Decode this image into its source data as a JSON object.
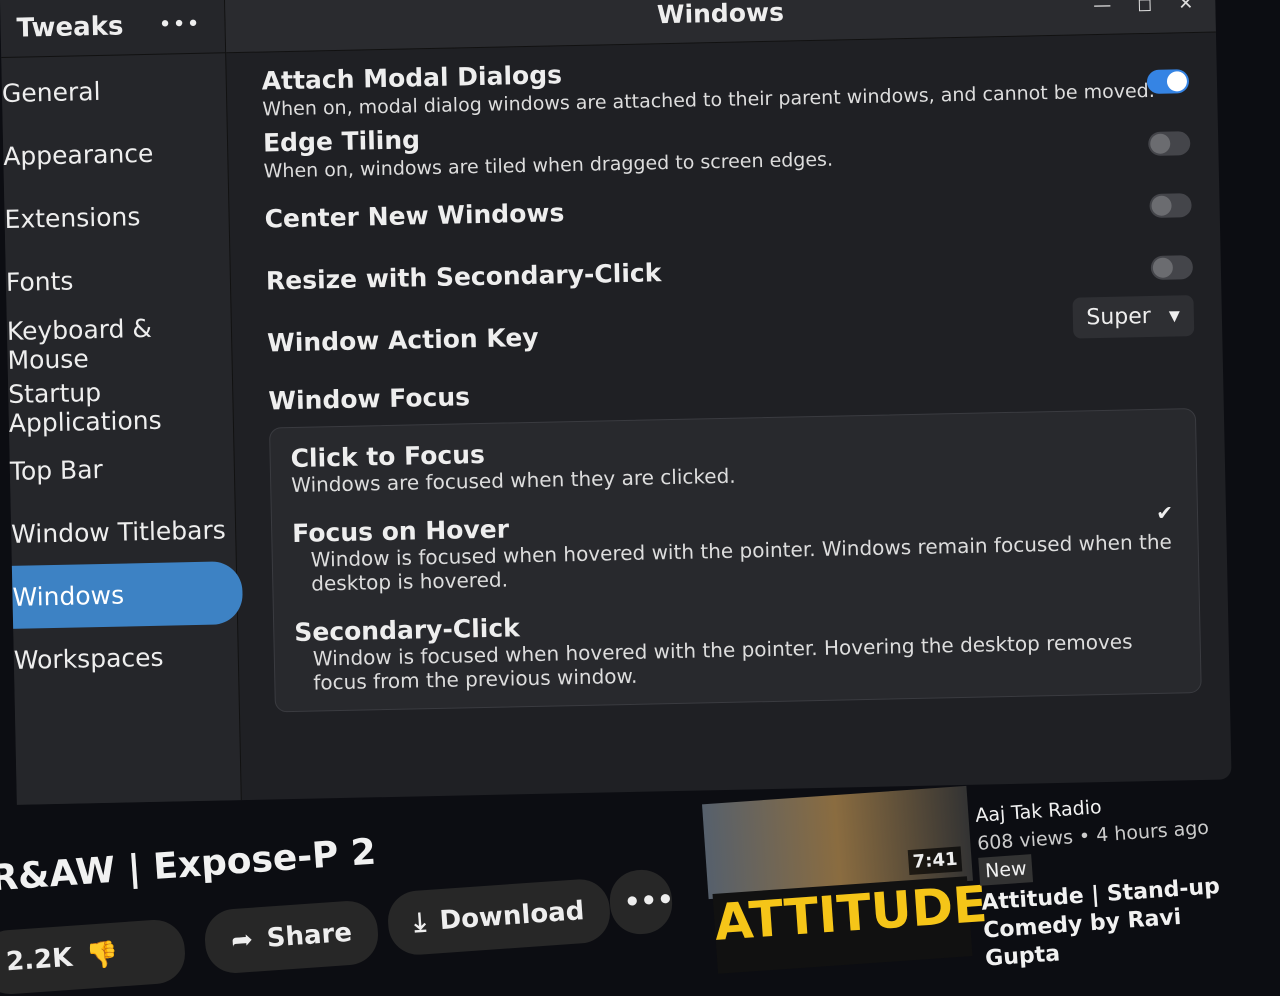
{
  "sidebar": {
    "title": "Tweaks",
    "menu_icon": "more-icon",
    "items": [
      {
        "label": "General"
      },
      {
        "label": "Appearance"
      },
      {
        "label": "Extensions"
      },
      {
        "label": "Fonts"
      },
      {
        "label": "Keyboard & Mouse"
      },
      {
        "label": "Startup Applications"
      },
      {
        "label": "Top Bar"
      },
      {
        "label": "Window Titlebars"
      },
      {
        "label": "Windows",
        "selected": true
      },
      {
        "label": "Workspaces"
      }
    ]
  },
  "header": {
    "title": "Windows"
  },
  "settings": [
    {
      "title": "Attach Modal Dialogs",
      "desc": "When on, modal dialog windows are attached to their parent windows, and cannot be moved.",
      "on": true
    },
    {
      "title": "Edge Tiling",
      "desc": "When on, windows are tiled when dragged to screen edges.",
      "on": false
    },
    {
      "title": "Center New Windows",
      "desc": "",
      "on": false
    },
    {
      "title": "Resize with Secondary-Click",
      "desc": "",
      "on": false
    }
  ],
  "action_key": {
    "label": "Window Action Key",
    "value": "Super"
  },
  "focus": {
    "title": "Window Focus",
    "options": [
      {
        "title": "Click to Focus",
        "desc": "Windows are focused when they are clicked."
      },
      {
        "title": "Focus on Hover",
        "desc": "Window is focused when hovered with the pointer. Windows remain focused when the desktop is hovered.",
        "checked": true
      },
      {
        "title": "Secondary-Click",
        "desc": "Window is focused when hovered with the pointer. Hovering the desktop removes focus from the previous window."
      }
    ]
  },
  "youtube": {
    "video_title": "R&AW | Expose-P 2",
    "likes": "2.2K",
    "share": "Share",
    "download": "Download",
    "rec": {
      "channel": "Aaj Tak Radio",
      "meta": "608 views • 4 hours ago",
      "badge": "New",
      "duration": "7:41",
      "title": "Attitude | Stand-up Comedy by Ravi Gupta",
      "thumb_text": "ATTITUDE"
    }
  }
}
